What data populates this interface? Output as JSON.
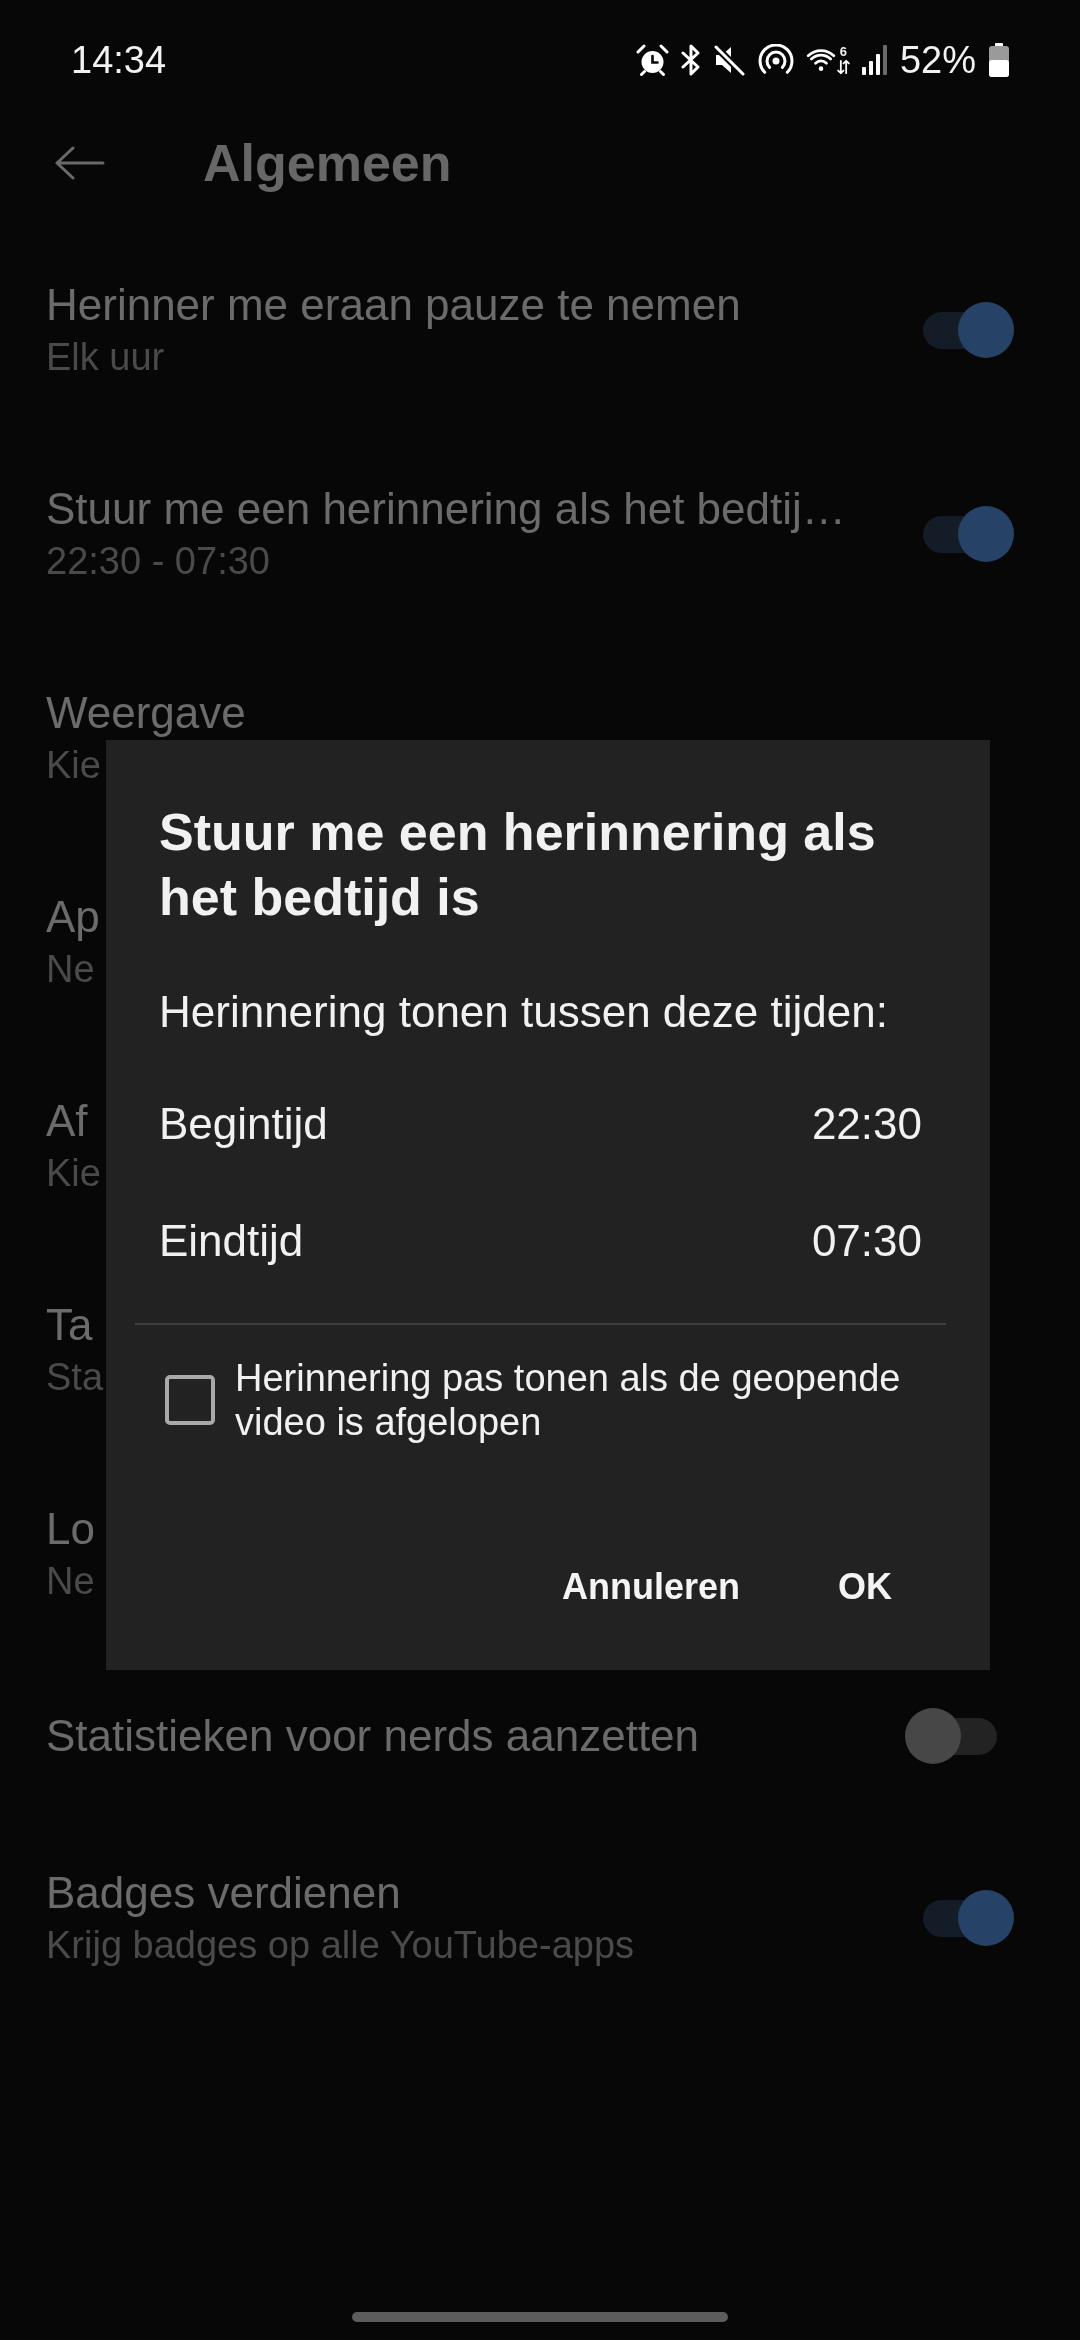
{
  "status_bar": {
    "time": "14:34",
    "wifi_generation": "6",
    "battery": "52%"
  },
  "app_bar": {
    "title": "Algemeen"
  },
  "settings": [
    {
      "kind": "switch",
      "title": "Herinner me eraan pauze te nemen",
      "subtitle": "Elk uur",
      "on": true
    },
    {
      "kind": "switch",
      "title": "Stuur me een herinnering als het bedtij…",
      "subtitle": "22:30 - 07:30",
      "on": true
    },
    {
      "kind": "link",
      "title": "Weergave",
      "subtitle": "Kie"
    },
    {
      "kind": "link",
      "title": "Ap",
      "subtitle": "Ne"
    },
    {
      "kind": "link",
      "title": "Af",
      "subtitle": "Kie"
    },
    {
      "kind": "link",
      "title": "Ta",
      "subtitle": "Sta"
    },
    {
      "kind": "link",
      "title": "Lo",
      "subtitle": "Ne"
    },
    {
      "kind": "switch",
      "title": "Statistieken voor nerds aanzetten",
      "on": false
    },
    {
      "kind": "switch",
      "title": "Badges verdienen",
      "subtitle": "Krijg badges op alle YouTube-apps",
      "on": true
    }
  ],
  "dialog": {
    "title": "Stuur me een herinnering als het bedtijd is",
    "message": "Herinnering tonen tussen deze tijden:",
    "times": [
      {
        "label": "Begintijd",
        "value": "22:30"
      },
      {
        "label": "Eindtijd",
        "value": "07:30"
      }
    ],
    "checkbox": {
      "label": "Herinnering pas tonen als de geopende video is afgelopen",
      "checked": false
    },
    "buttons": [
      "Annuleren",
      "OK"
    ]
  }
}
